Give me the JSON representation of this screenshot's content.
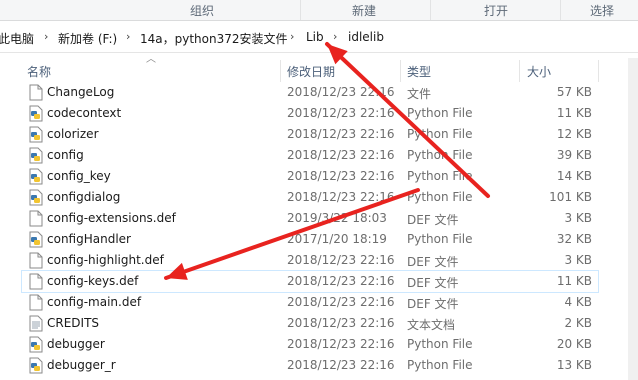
{
  "ribbon": {
    "groups": [
      "组织",
      "新建",
      "打开",
      "选择"
    ]
  },
  "breadcrumb": {
    "items": [
      "此电脑",
      "新加卷 (F:)",
      "14a，python372安装文件",
      "Lib",
      "idlelib"
    ]
  },
  "columns": {
    "name": "名称",
    "date": "修改日期",
    "type": "类型",
    "size": "大小"
  },
  "files": [
    {
      "name": "ChangeLog",
      "date": "2018/12/23 22:16",
      "type": "文件",
      "size": "57 KB",
      "icon": "file-icon"
    },
    {
      "name": "codecontext",
      "date": "2018/12/23 22:16",
      "type": "Python File",
      "size": "11 KB",
      "icon": "python-file-icon"
    },
    {
      "name": "colorizer",
      "date": "2018/12/23 22:16",
      "type": "Python File",
      "size": "12 KB",
      "icon": "python-file-icon"
    },
    {
      "name": "config",
      "date": "2018/12/23 22:16",
      "type": "Python File",
      "size": "39 KB",
      "icon": "python-file-icon"
    },
    {
      "name": "config_key",
      "date": "2018/12/23 22:16",
      "type": "Python File",
      "size": "14 KB",
      "icon": "python-file-icon"
    },
    {
      "name": "configdialog",
      "date": "2018/12/23 22:16",
      "type": "Python File",
      "size": "101 KB",
      "icon": "python-file-icon"
    },
    {
      "name": "config-extensions.def",
      "date": "2019/3/22 18:03",
      "type": "DEF 文件",
      "size": "3 KB",
      "icon": "file-icon"
    },
    {
      "name": "configHandler",
      "date": "2017/1/20 18:19",
      "type": "Python File",
      "size": "32 KB",
      "icon": "python-file-icon"
    },
    {
      "name": "config-highlight.def",
      "date": "2018/12/23 22:16",
      "type": "DEF 文件",
      "size": "3 KB",
      "icon": "file-icon"
    },
    {
      "name": "config-keys.def",
      "date": "2018/12/23 22:16",
      "type": "DEF 文件",
      "size": "11 KB",
      "icon": "file-icon"
    },
    {
      "name": "config-main.def",
      "date": "2018/12/23 22:16",
      "type": "DEF 文件",
      "size": "4 KB",
      "icon": "file-icon"
    },
    {
      "name": "CREDITS",
      "date": "2018/12/23 22:16",
      "type": "文本文档",
      "size": "2 KB",
      "icon": "text-file-icon"
    },
    {
      "name": "debugger",
      "date": "2018/12/23 22:16",
      "type": "Python File",
      "size": "20 KB",
      "icon": "python-file-icon"
    },
    {
      "name": "debugger_r",
      "date": "2018/12/23 22:16",
      "type": "Python File",
      "size": "13 KB",
      "icon": "python-file-icon"
    }
  ],
  "annotation_color": "#e8231f"
}
